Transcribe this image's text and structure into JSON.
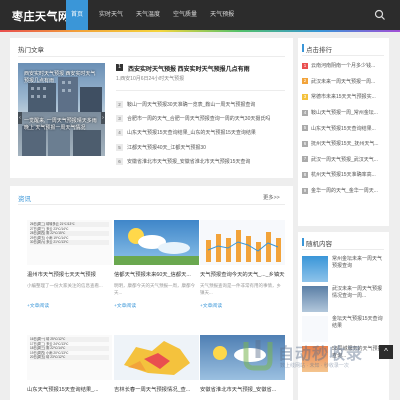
{
  "header": {
    "logo": "枣庄天气网",
    "nav": [
      "首页",
      "实时天气",
      "天气温度",
      "空气质量",
      "天气预报"
    ],
    "active_index": 0
  },
  "hot": {
    "title": "热门文章",
    "images": [
      {
        "caption": "西安实时天气预报 西安实时天气预报几点有雨"
      },
      {
        "caption": "一觉醒来, 一周天气预报晴天多雨晚上 天气预报一周天气情况"
      }
    ],
    "feature_mark": "1",
    "feature_title": "西安实时天气预报 西安实时天气预报几点有雨",
    "feature_meta": "1.西安10月6日24小时天气预报",
    "list": [
      {
        "num": "2",
        "text": "鞍山一周天气预报30天准确一览表_鞍山一周天气预报查询"
      },
      {
        "num": "3",
        "text": "合肥市一周的天气_合肥一周天气预报查询一周的天气30天摄氏吗"
      },
      {
        "num": "4",
        "text": "山东天气预报15天查询结果_山东的天气预报15天查询结果"
      },
      {
        "num": "5",
        "text": "江都天气预报40天_江都天气预报30"
      },
      {
        "num": "6",
        "text": "安徽省淮北市天气预报_安徽省淮北市天气预报15天查询"
      }
    ]
  },
  "ranking": {
    "title": "点击排行",
    "items": [
      {
        "num": "1",
        "color": "#e94f4f",
        "text": "云南河南阴南一个月多少钱..."
      },
      {
        "num": "2",
        "color": "#f2a33a",
        "text": "武汉未来一周天气预报一周..."
      },
      {
        "num": "3",
        "color": "#f4c23d",
        "text": "常德市未来15天天气预报实..."
      },
      {
        "num": "4",
        "color": "#aaaaaa",
        "text": "鞍山天气预报一周_常州金坛..."
      },
      {
        "num": "5",
        "color": "#aaaaaa",
        "text": "山东天气预报15天查询结果..."
      },
      {
        "num": "6",
        "color": "#aaaaaa",
        "text": "抚州天气预报15天_抚州天气..."
      },
      {
        "num": "7",
        "color": "#aaaaaa",
        "text": "武汉一周天气预报_武汉天气..."
      },
      {
        "num": "8",
        "color": "#aaaaaa",
        "text": "杭州天气预报15天准确率高..."
      },
      {
        "num": "9",
        "color": "#aaaaaa",
        "text": "金华一周的天气_金华一周天..."
      }
    ]
  },
  "news": {
    "title": "资讯",
    "more": "更多>>",
    "cards": [
      {
        "title": "温州市天气预报七天天气预报",
        "desc": "小编整理了一份大家关注的信息查看...",
        "tag": "+文章阅读",
        "rows": [
          "26日(周二) 晴转多云 21℃/13℃",
          "27日(周三) 多云 23℃/14℃",
          "28日(周四) 阴 22℃/15℃",
          "29日(周五) 小雨 19℃/14℃",
          "30日(周六) 多云 21℃/13℃"
        ]
      },
      {
        "title": "信都天气预报未来60天_信都天...",
        "desc": "明明，康都今天的天气预报一周，康都今天...",
        "tag": "+文章阅读"
      },
      {
        "title": "天气预报查询今天的天气_..._乡镇天气预报",
        "desc": "天气预报查询是一件非常有用的事情，乡镇天...",
        "tag": "+文章阅读"
      },
      {
        "title": "山东天气预报15天查询结果_...",
        "desc": "",
        "tag": "",
        "rows": [
          "16日(周一) 晴 25℃/12℃",
          "17日(周二) 多云 24℃/13℃",
          "18日(周三) 阴 22℃/14℃",
          "19日(周四) 小雨 20℃/13℃",
          "20日(周五) 晴 23℃/12℃"
        ]
      },
      {
        "title": "吉林长春一周天气预报情况_查...",
        "desc": "",
        "tag": ""
      },
      {
        "title": "安徽省淮北市天气预报_安徽省...",
        "desc": "",
        "tag": ""
      }
    ]
  },
  "random": {
    "title": "随机内容",
    "items": [
      {
        "text": "常州金坛未来一周天气预报查询"
      },
      {
        "text": "武汉未来一周天气预报情况查询一周..."
      },
      {
        "text": "金坛天气预报15天查询结果"
      },
      {
        "text": "58同城服务的天气预报查询..."
      }
    ]
  },
  "watermark": {
    "text": "自动秒收录",
    "sub": "数上线网站 · 未知 · 秒收录一次"
  },
  "back_top": "^"
}
